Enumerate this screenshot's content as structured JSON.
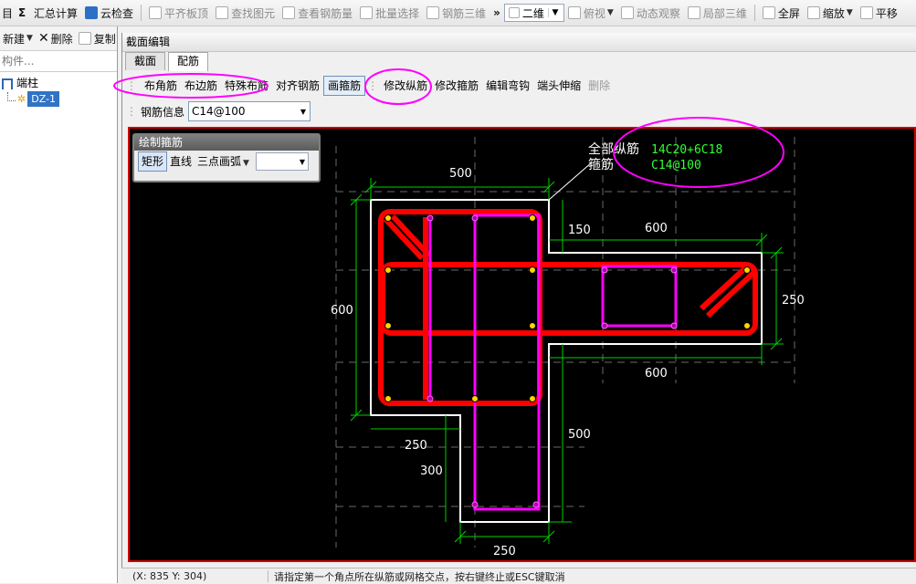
{
  "toolbar": {
    "items": [
      {
        "label": "汇总计算",
        "icon": "sum-icon"
      },
      {
        "label": "云检查",
        "icon": "cloud-check-icon"
      },
      {
        "label": "平齐板顶",
        "icon": "align-top-icon"
      },
      {
        "label": "查找图元",
        "icon": "find-icon"
      },
      {
        "label": "查看钢筋量",
        "icon": "view-rebar-icon"
      },
      {
        "label": "批量选择",
        "icon": "batch-select-icon"
      },
      {
        "label": "钢筋三维",
        "icon": "rebar-3d-icon"
      }
    ],
    "overflow": "»",
    "view_mode": "二维",
    "view_items": [
      "俯视",
      "动态观察",
      "局部三维",
      "全屏",
      "缩放",
      "平移"
    ]
  },
  "left_panel": {
    "new_label": "新建",
    "delete_label": "删除",
    "copy_label": "复制",
    "search_placeholder": "构件...",
    "tree_root": "端柱",
    "tree_child": "DZ-1"
  },
  "editor": {
    "title": "截面编辑",
    "tabs": [
      "截面",
      "配筋"
    ],
    "rebar_tools": [
      "布角筋",
      "布边筋",
      "特殊布筋",
      "对齐钢筋",
      "画箍筋",
      "修改纵筋",
      "修改箍筋",
      "编辑弯钩",
      "端头伸缩",
      "删除"
    ],
    "rebar_info_label": "钢筋信息",
    "rebar_info_value": "C14@100"
  },
  "draw_panel": {
    "title": "绘制箍筋",
    "buttons": [
      "矩形",
      "直线",
      "三点画弧"
    ]
  },
  "drawing": {
    "label_all_longitudinal": "全部纵筋",
    "label_stirrup": "箍筋",
    "value_longitudinal": "14C20+6C18",
    "value_stirrup": "C14@100",
    "dims": {
      "top_width": "500",
      "side_height": "600",
      "right_top": "150",
      "right_width_top": "600",
      "right_height": "250",
      "right_width_bottom": "600",
      "bottom_left": "250",
      "bottom_side": "300",
      "bottom_height": "500",
      "bottom_width": "250"
    },
    "colors": {
      "outline": "#ffffff",
      "main_rebar": "#ff0000",
      "stirrup": "#ff00ff",
      "dimension": "#00d000",
      "text_value": "#33ff33",
      "annotation": "#ff00ff",
      "canvas_border": "#d00000"
    }
  },
  "status": {
    "coords": "(X: 835 Y: 304)",
    "message": "请指定第一个角点所在纵筋或网格交点，按右键终止或ESC键取消"
  }
}
